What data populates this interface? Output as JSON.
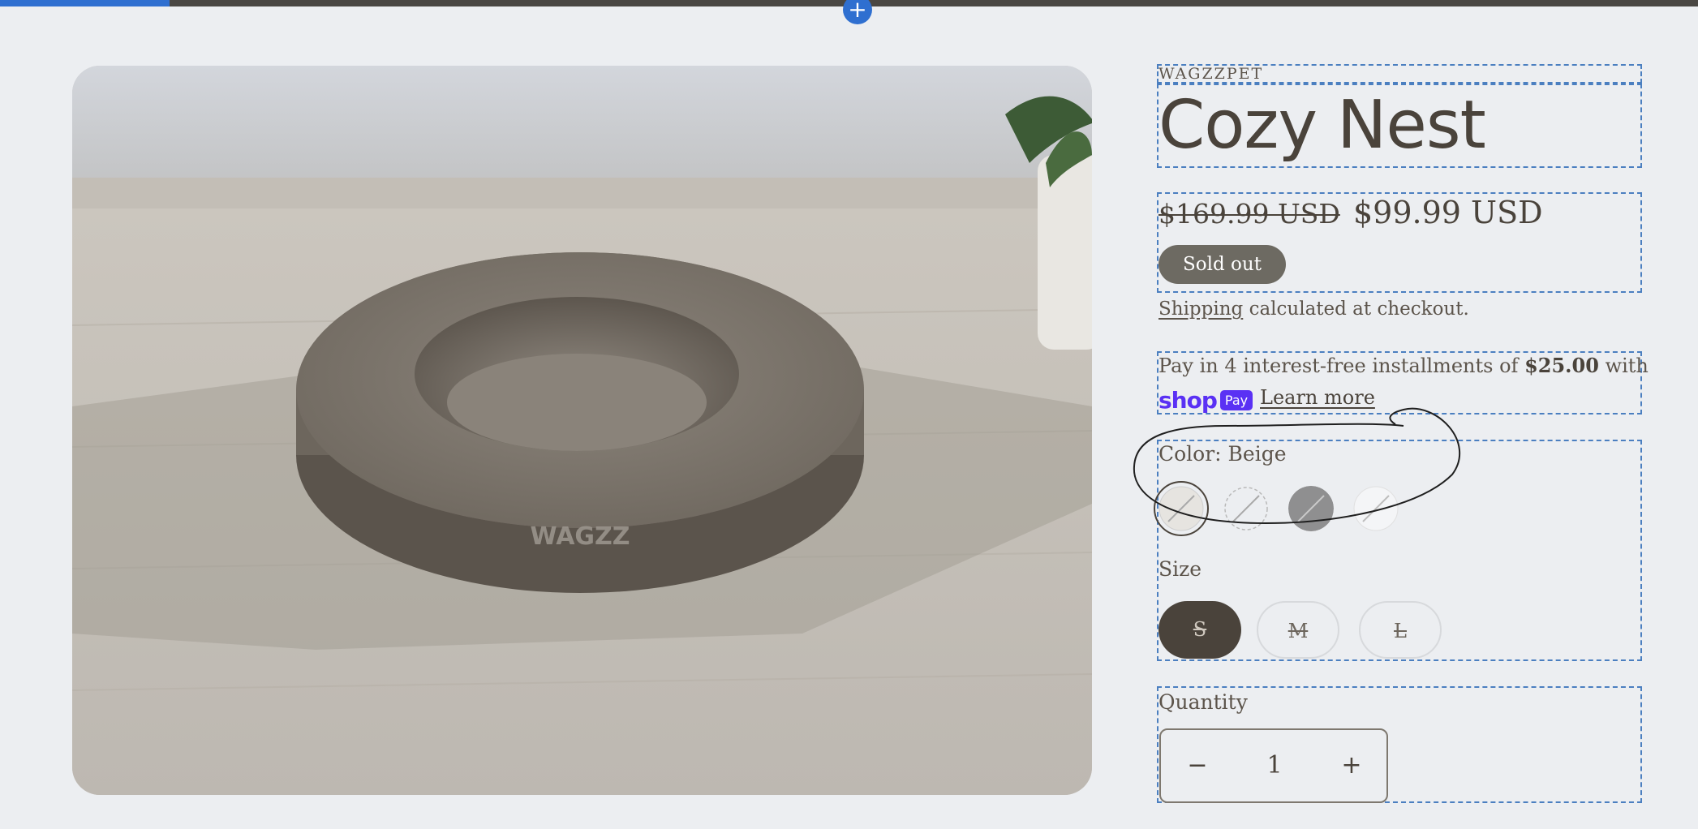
{
  "editor": {
    "add_icon": "plus-icon",
    "add_glyph": "+",
    "progress_fraction": 0.1
  },
  "product": {
    "vendor": "WAGZZPET",
    "title": "Cozy Nest",
    "image_alt": "Round bouclé pet bed",
    "image_brand_text": "WAGZZ",
    "price_compare": "$169.99 USD",
    "price_sale": "$99.99 USD",
    "sold_out_label": "Sold out",
    "shipping_link": "Shipping",
    "shipping_rest": " calculated at checkout.",
    "installments_prefix": "Pay in 4 interest-free installments of ",
    "installments_amount": "$25.00",
    "installments_suffix": " with",
    "shop_word": "shop",
    "pay_word": "Pay",
    "learn_more": "Learn more",
    "color_label": "Color: Beige",
    "swatches": [
      {
        "name": "Beige",
        "color": "#e6e4e0",
        "selected": true,
        "unavailable": true
      },
      {
        "name": "Cream",
        "color": "#eceef1",
        "selected": false,
        "unavailable": true
      },
      {
        "name": "Grey",
        "color": "#8f8f90",
        "selected": false,
        "unavailable": true
      },
      {
        "name": "White",
        "color": "#f4f5f7",
        "selected": false,
        "unavailable": true
      }
    ],
    "size_label": "Size",
    "sizes": [
      {
        "label": "S",
        "selected": true
      },
      {
        "label": "M",
        "selected": false
      },
      {
        "label": "L",
        "selected": false
      }
    ],
    "quantity_label": "Quantity",
    "quantity_value": "1",
    "quantity_minus": "−",
    "quantity_plus": "+"
  },
  "colors": {
    "accent_blue": "#2f6fd0",
    "text_dark": "#4a433b",
    "badge_bg": "#6d6a62",
    "shop_pay": "#5a31f4"
  }
}
